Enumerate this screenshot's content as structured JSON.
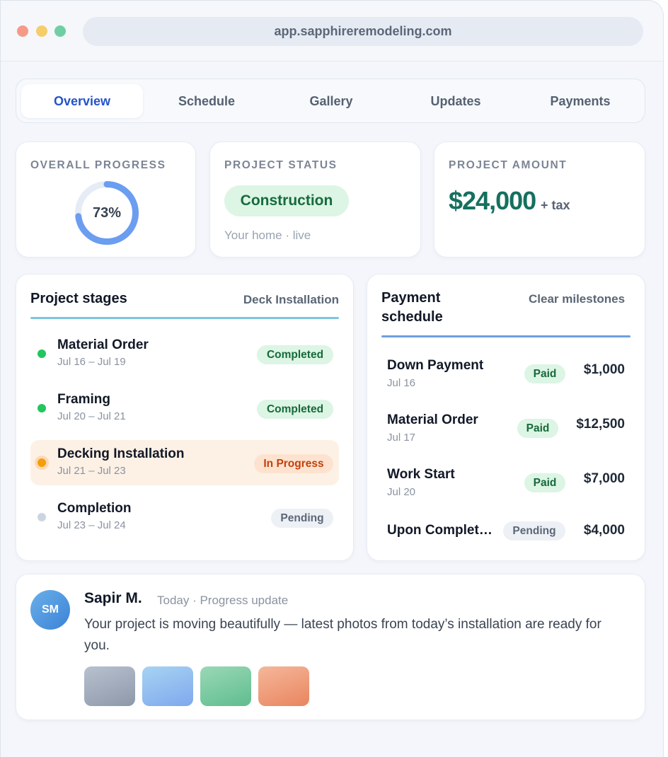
{
  "browser": {
    "url": "app.sapphireremodeling.com"
  },
  "tabs": [
    "Overview",
    "Schedule",
    "Gallery",
    "Updates",
    "Payments"
  ],
  "progress": {
    "label": "OVERALL PROGRESS",
    "value_text": "73%",
    "value": 73
  },
  "status": {
    "label": "PROJECT STATUS",
    "value": "Construction",
    "sub": "Your home · live"
  },
  "amount": {
    "label": "PROJECT AMOUNT",
    "value": "$24,000",
    "suffix": "+ tax"
  },
  "stages": {
    "title": "Project stages",
    "current": "Deck Installation",
    "items": [
      {
        "name": "Material Order",
        "dates": "Jul 16 – Jul 19",
        "status": "Completed"
      },
      {
        "name": "Framing",
        "dates": "Jul 20 – Jul 21",
        "status": "Completed"
      },
      {
        "name": "Decking Installation",
        "dates": "Jul 21 – Jul 23",
        "status": "In Progress"
      },
      {
        "name": "Completion",
        "dates": "Jul 23 – Jul 24",
        "status": "Pending"
      }
    ]
  },
  "payments": {
    "title": "Payment schedule",
    "subtitle": "Clear milestones",
    "items": [
      {
        "name": "Down Payment",
        "date": "Jul 16",
        "status": "Paid",
        "amount": "$1,000"
      },
      {
        "name": "Material Order",
        "date": "Jul 17",
        "status": "Paid",
        "amount": "$12,500"
      },
      {
        "name": "Work Start",
        "date": "Jul 20",
        "status": "Paid",
        "amount": "$7,000"
      },
      {
        "name": "Upon Complet…",
        "date": "",
        "status": "Pending",
        "amount": "$4,000"
      }
    ]
  },
  "update": {
    "initials": "SM",
    "author": "Sapir M.",
    "meta": "Today · Progress update",
    "message": "Your project is moving beautifully — latest photos from today’s installation are ready for you.",
    "photo_colors": [
      "#a9b3c3",
      "#8fbdf0",
      "#7ccca3",
      "#ef9f7d"
    ]
  },
  "colors": {
    "accent": "#2453c9",
    "success": "#22c55e",
    "warning": "#f59e0b",
    "pending": "#cbd5e1",
    "amount": "#15705f",
    "progress_ring": "#6b9df0"
  }
}
